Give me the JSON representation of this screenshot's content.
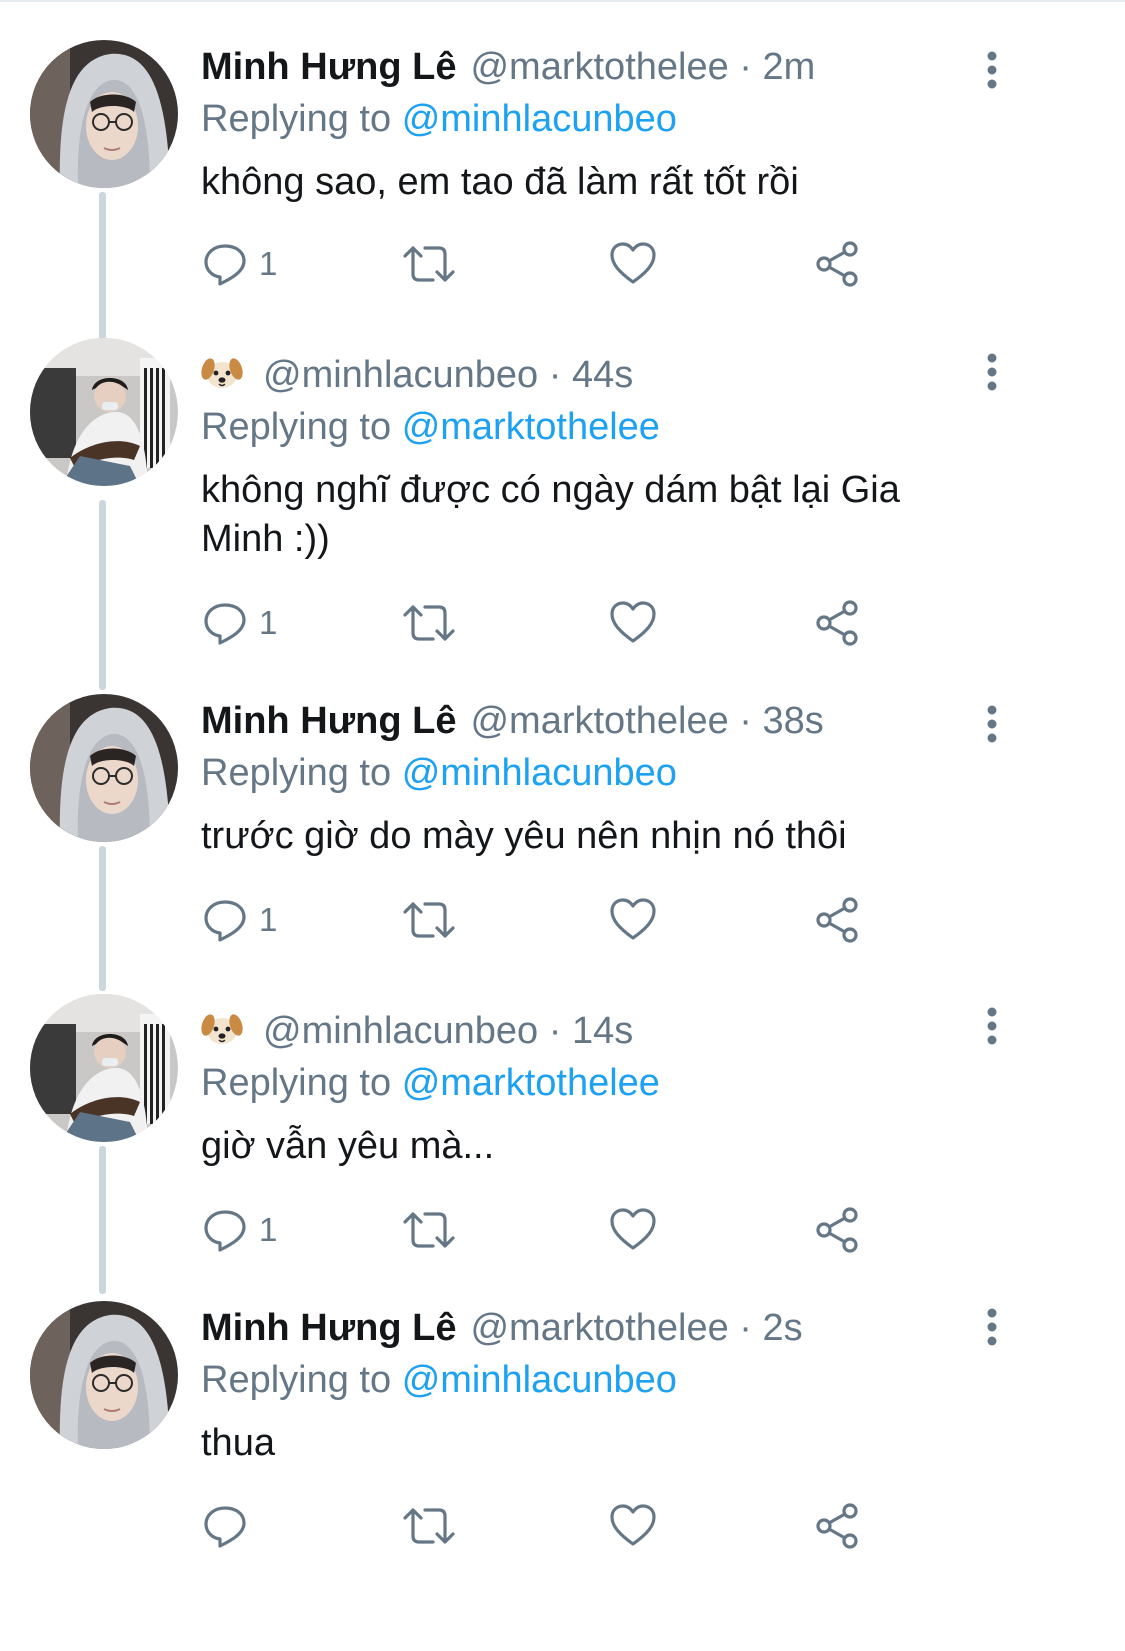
{
  "colors": {
    "accent": "#1da1f2",
    "muted": "#657786",
    "text": "#14171a",
    "thread_line": "#ccd6dd"
  },
  "reply_prefix": "Replying to",
  "tweets": [
    {
      "display_name": "Minh Hưng Lê",
      "emoji_name": "",
      "handle_time": "@marktothelee · 2m",
      "avatar": "hooded-person-avatar",
      "replying_to": "@minhlacunbeo",
      "text": "không sao, em tao đã làm rất tốt rồi",
      "reply_count": "1"
    },
    {
      "display_name": "",
      "emoji_name": "dog-face-emoji",
      "handle_time": "@minhlacunbeo · 44s",
      "avatar": "guitar-player-avatar",
      "replying_to": "@marktothelee",
      "text": "không nghĩ được có ngày dám bật lại Gia Minh :))",
      "reply_count": "1"
    },
    {
      "display_name": "Minh Hưng Lê",
      "emoji_name": "",
      "handle_time": "@marktothelee · 38s",
      "avatar": "hooded-person-avatar",
      "replying_to": "@minhlacunbeo",
      "text": "trước giờ do mày yêu nên nhịn nó thôi",
      "reply_count": "1"
    },
    {
      "display_name": "",
      "emoji_name": "dog-face-emoji",
      "handle_time": "@minhlacunbeo · 14s",
      "avatar": "guitar-player-avatar",
      "replying_to": "@marktothelee",
      "text": "giờ vẫn yêu mà...",
      "reply_count": "1"
    },
    {
      "display_name": "Minh Hưng Lê",
      "emoji_name": "",
      "handle_time": "@marktothelee · 2s",
      "avatar": "hooded-person-avatar",
      "replying_to": "@minhlacunbeo",
      "text": "thua",
      "reply_count": ""
    }
  ]
}
